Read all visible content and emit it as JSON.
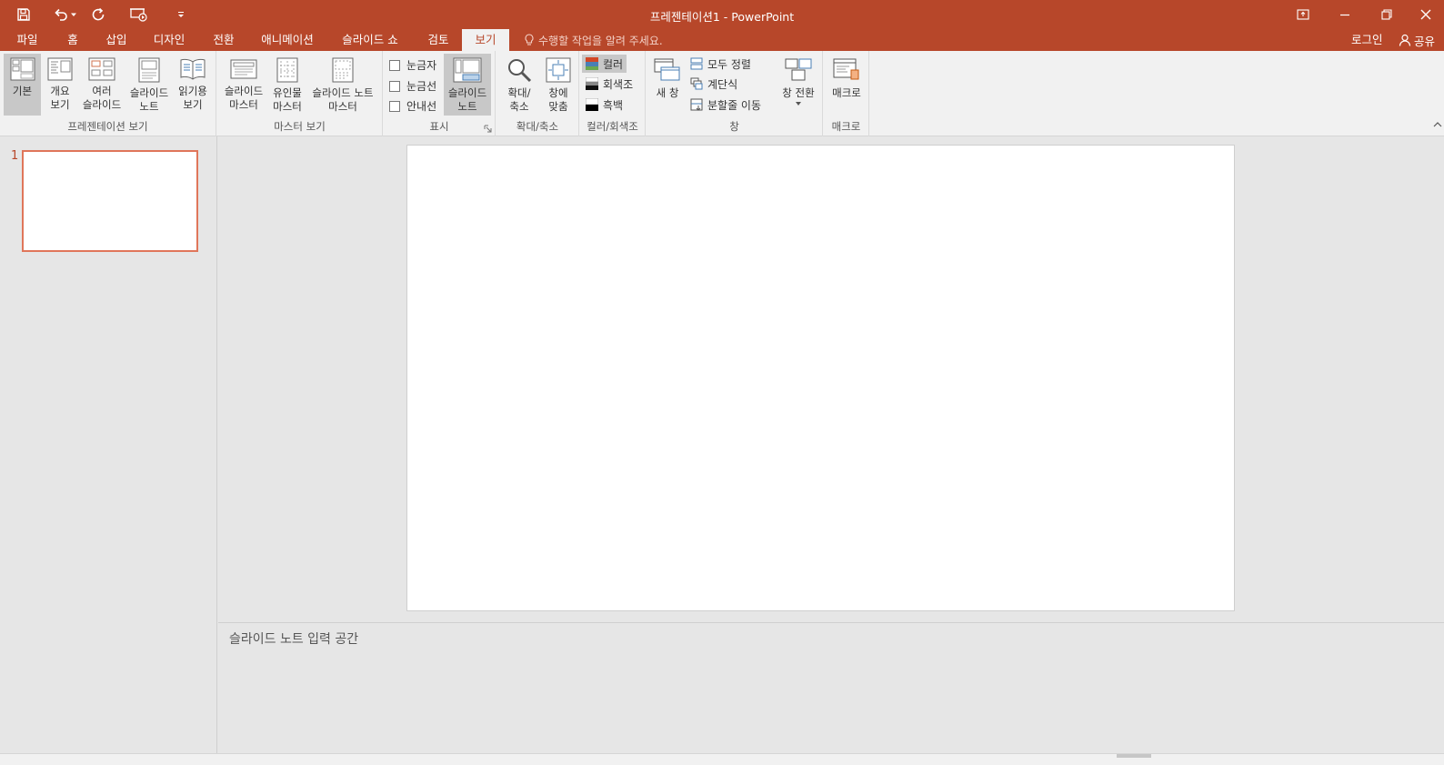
{
  "title": "프레젠테이션1 - PowerPoint",
  "colors": {
    "accent": "#b7472a",
    "ribbon": "#f1f1f1",
    "selection": "#e0765a"
  },
  "qat": {
    "icons": [
      "save-icon",
      "undo-icon",
      "redo-icon",
      "start-from-beginning-icon",
      "customize-qat-icon"
    ]
  },
  "tabs": [
    {
      "label": "파일",
      "active": false
    },
    {
      "label": "홈",
      "active": false
    },
    {
      "label": "삽입",
      "active": false
    },
    {
      "label": "디자인",
      "active": false
    },
    {
      "label": "전환",
      "active": false
    },
    {
      "label": "애니메이션",
      "active": false
    },
    {
      "label": "슬라이드 쇼",
      "active": false
    },
    {
      "label": "검토",
      "active": false
    },
    {
      "label": "보기",
      "active": true
    }
  ],
  "tell_me": "수행할 작업을 알려 주세요.",
  "login": "로그인",
  "share": "공유",
  "ribbon": {
    "presentation_views": {
      "label": "프레젠테이션 보기",
      "normal": "기본",
      "outline": "개요\n보기",
      "sorter": "여러\n슬라이드",
      "notes_page": "슬라이드\n노트",
      "reading": "읽기용\n보기"
    },
    "master_views": {
      "label": "마스터 보기",
      "slide_master": "슬라이드\n마스터",
      "handout_master": "유인물\n마스터",
      "notes_master": "슬라이드 노트\n마스터"
    },
    "show": {
      "label": "표시",
      "ruler": "눈금자",
      "gridlines": "눈금선",
      "guides": "안내선",
      "notes": "슬라이드\n노트"
    },
    "zoom": {
      "label": "확대/축소",
      "zoom": "확대/\n축소",
      "fit": "창에\n맞춤"
    },
    "color": {
      "label": "컬러/회색조",
      "color": "컬러",
      "grayscale": "회색조",
      "bw": "흑백"
    },
    "window": {
      "label": "창",
      "new_window": "새 창",
      "arrange_all": "모두 정렬",
      "cascade": "계단식",
      "move_split": "분할줄 이동",
      "switch": "창 전환"
    },
    "macros": {
      "label": "매크로",
      "macros": "매크로"
    }
  },
  "thumbnail": {
    "number": "1"
  },
  "notes_placeholder": "슬라이드 노트 입력 공간"
}
